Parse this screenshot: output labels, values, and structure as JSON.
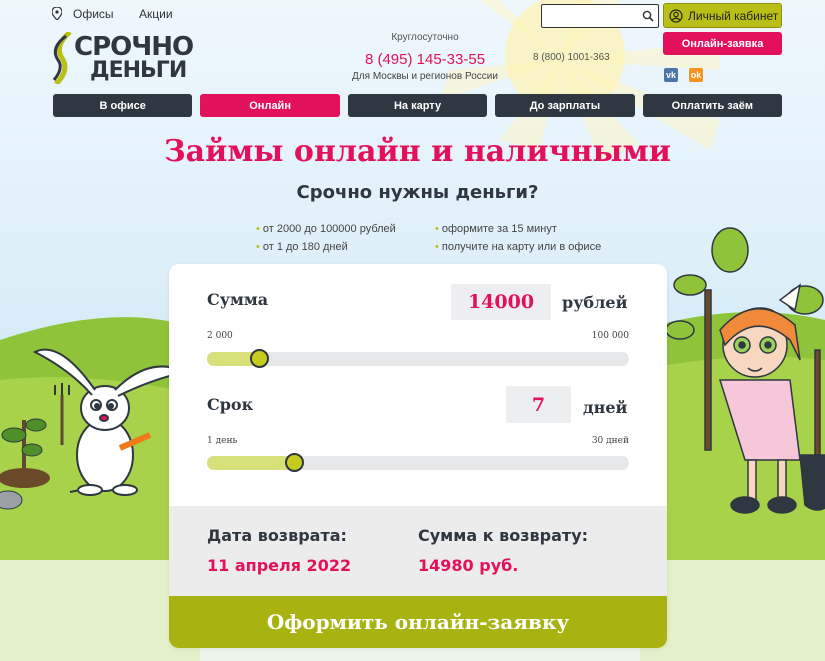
{
  "top_links": {
    "offices": "Офисы",
    "promos": "Акции"
  },
  "logo": {
    "line1": "СРОЧНО",
    "line2": "ДЕНЬГИ"
  },
  "contacts": {
    "hours": "Круглосуточно",
    "phone": "8 (495) 145-33-55",
    "region": "Для Москвы и регионов России",
    "phone2": "8 (800) 1001-363"
  },
  "search": {
    "placeholder": ""
  },
  "cabinet_label": "Личный кабинет",
  "apply_label": "Онлайн-заявка",
  "social": {
    "vk": "vk",
    "ok": "ok"
  },
  "nav": [
    {
      "label": "В офисе",
      "active": false
    },
    {
      "label": "Онлайн",
      "active": true
    },
    {
      "label": "На карту",
      "active": false
    },
    {
      "label": "До зарплаты",
      "active": false
    },
    {
      "label": "Оплатить заём",
      "active": false
    }
  ],
  "hero": {
    "title": "Займы онлайн и наличными",
    "subtitle": "Срочно нужны деньги?",
    "bullets_left": [
      "от 2000 до 100000 рублей",
      "от 1 до 180 дней"
    ],
    "bullets_right": [
      "оформите за 15 минут",
      "получите на карту или в офисе"
    ]
  },
  "calculator": {
    "amount": {
      "label": "Сумма",
      "value": "14000",
      "unit": "рублей",
      "min_label": "2 000",
      "max_label": "100 000",
      "min": 2000,
      "max": 100000,
      "current": 14000
    },
    "term": {
      "label": "Срок",
      "value": "7",
      "unit": "дней",
      "min_label": "1 день",
      "max_label": "30 дней",
      "min": 1,
      "max": 30,
      "current": 7
    },
    "return_date_label": "Дата возврата:",
    "return_date": "11 апреля 2022",
    "return_sum_label": "Сумма к возврату:",
    "return_sum": "14980 руб.",
    "submit_label": "Оформить онлайн-заявку"
  },
  "colors": {
    "accent": "#e3115c",
    "lime": "#b9bf16",
    "dark": "#2f3740"
  }
}
